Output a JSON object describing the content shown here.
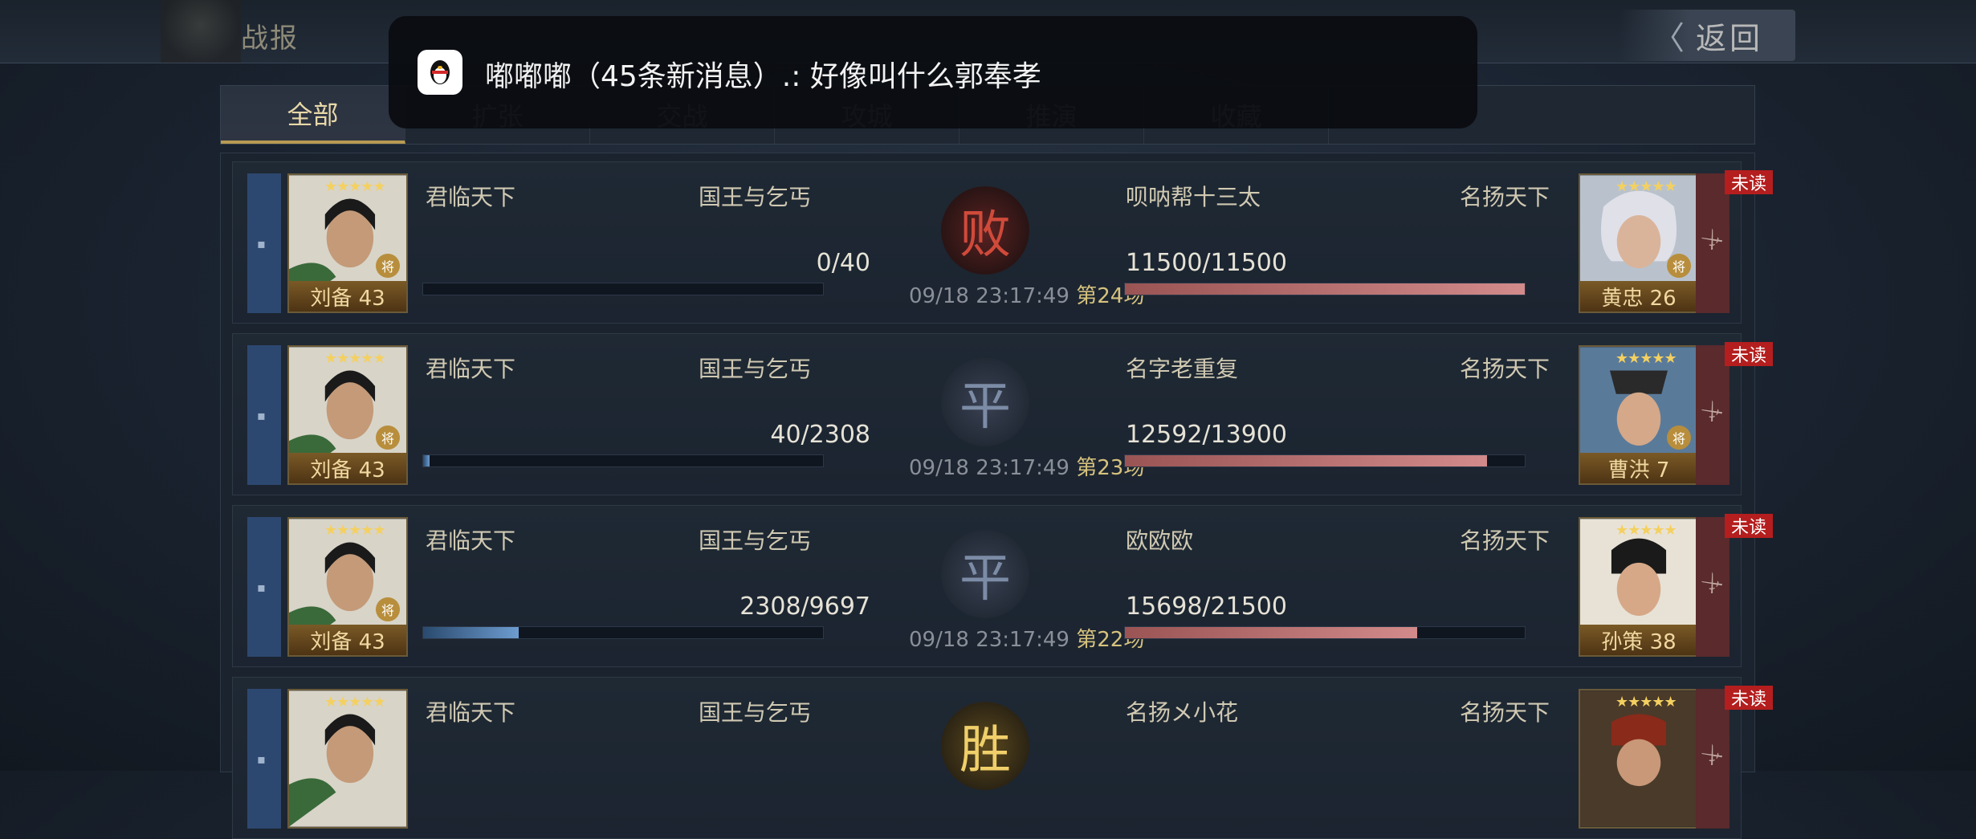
{
  "header": {
    "title": "战报",
    "back_label": "返回"
  },
  "notification": {
    "text": "嘟嘟嘟（45条新消息）.: 好像叫什么郭奉孝"
  },
  "tabs": [
    {
      "label": "全部",
      "active": true
    },
    {
      "label": "扩张",
      "active": false
    },
    {
      "label": "交战",
      "active": false
    },
    {
      "label": "攻城",
      "active": false
    },
    {
      "label": "推演",
      "active": false
    },
    {
      "label": "收藏",
      "active": false
    }
  ],
  "colors": {
    "accent": "#b89a52",
    "unread_badge": "#b41e1e",
    "blue_bar": "#6d9cd0",
    "red_bar": "#d28a8a"
  },
  "reports": [
    {
      "left_general": "刘备 43",
      "left_stars": "★★★★★",
      "left_alliance": "君临天下",
      "left_player": "国王与乞丐",
      "left_troops": "0/40",
      "left_fill": 0.0,
      "result": "败",
      "result_type": "lose",
      "time": "09/18 23:17:49",
      "round": "第24场",
      "right_player": "呗呐帮十三太",
      "right_alliance": "名扬天下",
      "right_troops": "11500/11500",
      "right_fill": 1.0,
      "right_general": "黄忠 26",
      "right_stars": "★★★★★",
      "unread": "未读"
    },
    {
      "left_general": "刘备 43",
      "left_stars": "★★★★★",
      "left_alliance": "君临天下",
      "left_player": "国王与乞丐",
      "left_troops": "40/2308",
      "left_fill": 0.017,
      "result": "平",
      "result_type": "tie",
      "time": "09/18 23:17:49",
      "round": "第23场",
      "right_player": "名字老重复",
      "right_alliance": "名扬天下",
      "right_troops": "12592/13900",
      "right_fill": 0.906,
      "right_general": "曹洪 7",
      "right_stars": "★★★★★",
      "unread": "未读"
    },
    {
      "left_general": "刘备 43",
      "left_stars": "★★★★★",
      "left_alliance": "君临天下",
      "left_player": "国王与乞丐",
      "left_troops": "2308/9697",
      "left_fill": 0.238,
      "result": "平",
      "result_type": "tie",
      "time": "09/18 23:17:49",
      "round": "第22场",
      "right_player": "欧欧欧",
      "right_alliance": "名扬天下",
      "right_troops": "15698/21500",
      "right_fill": 0.73,
      "right_general": "孙策 38",
      "right_stars": "★★★★★",
      "unread": "未读"
    },
    {
      "left_general": "",
      "left_stars": "★★★★★",
      "left_alliance": "君临天下",
      "left_player": "国王与乞丐",
      "left_troops": "",
      "left_fill": 0,
      "result": "胜",
      "result_type": "win",
      "time": "",
      "round": "",
      "right_player": "名扬メ小花",
      "right_alliance": "名扬天下",
      "right_troops": "",
      "right_fill": 0,
      "right_general": "",
      "right_stars": "★★★★★",
      "unread": "未读"
    }
  ]
}
